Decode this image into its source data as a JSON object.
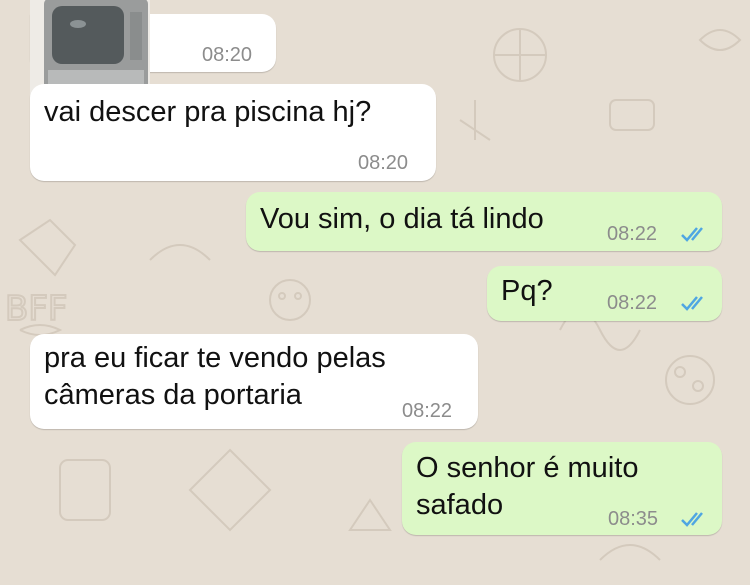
{
  "chat": {
    "messages": [
      {
        "id": "m1",
        "direction": "incoming",
        "kind": "image",
        "time": "08:20",
        "image_icon": "tv-photo-thumbnail"
      },
      {
        "id": "m2",
        "direction": "incoming",
        "text_lines": [
          "vai descer pra piscina hj?"
        ],
        "time": "08:20"
      },
      {
        "id": "m3",
        "direction": "outgoing",
        "text_lines": [
          "Vou sim, o dia tá lindo"
        ],
        "time": "08:22",
        "status": "read"
      },
      {
        "id": "m4",
        "direction": "outgoing",
        "text_lines": [
          "Pq?"
        ],
        "time": "08:22",
        "status": "read"
      },
      {
        "id": "m5",
        "direction": "incoming",
        "text_lines": [
          "pra eu ficar te vendo pelas",
          "câmeras da portaria"
        ],
        "time": "08:22"
      },
      {
        "id": "m6",
        "direction": "outgoing",
        "text_lines": [
          "O senhor é muito",
          "safado"
        ],
        "time": "08:35",
        "status": "read"
      }
    ]
  },
  "colors": {
    "wallpaper": "#e6ded3",
    "incoming_bubble": "#ffffff",
    "outgoing_bubble": "#dcf8c6",
    "read_ticks": "#4fa6e2",
    "timestamp": "#8c8c8c"
  },
  "icons": {
    "read_receipt": "double-check-icon"
  }
}
